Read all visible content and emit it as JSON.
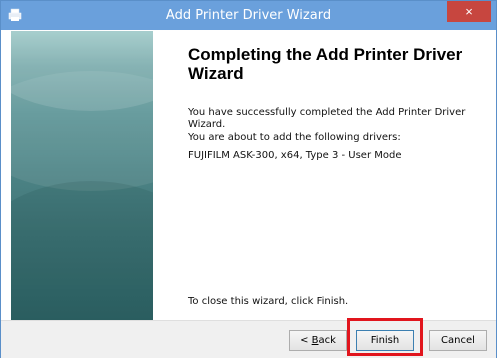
{
  "window": {
    "title": "Add Printer Driver Wizard",
    "close_glyph": "×",
    "title_icon": "printer-icon"
  },
  "content": {
    "heading": "Completing the Add Printer Driver Wizard",
    "success_msg": "You have successfully completed the Add Printer Driver Wizard.",
    "about_msg": "You are about to add the following drivers:",
    "driver": "FUJIFILM ASK-300, x64, Type 3 - User Mode",
    "close_hint": "To close this wizard, click Finish."
  },
  "buttons": {
    "back": "< Back",
    "back_accesskey": "B",
    "finish": "Finish",
    "cancel": "Cancel"
  },
  "colors": {
    "titlebar": "#6aa0dc",
    "close": "#c7463f",
    "highlight": "#e1151d",
    "panel": "#4d8486"
  }
}
